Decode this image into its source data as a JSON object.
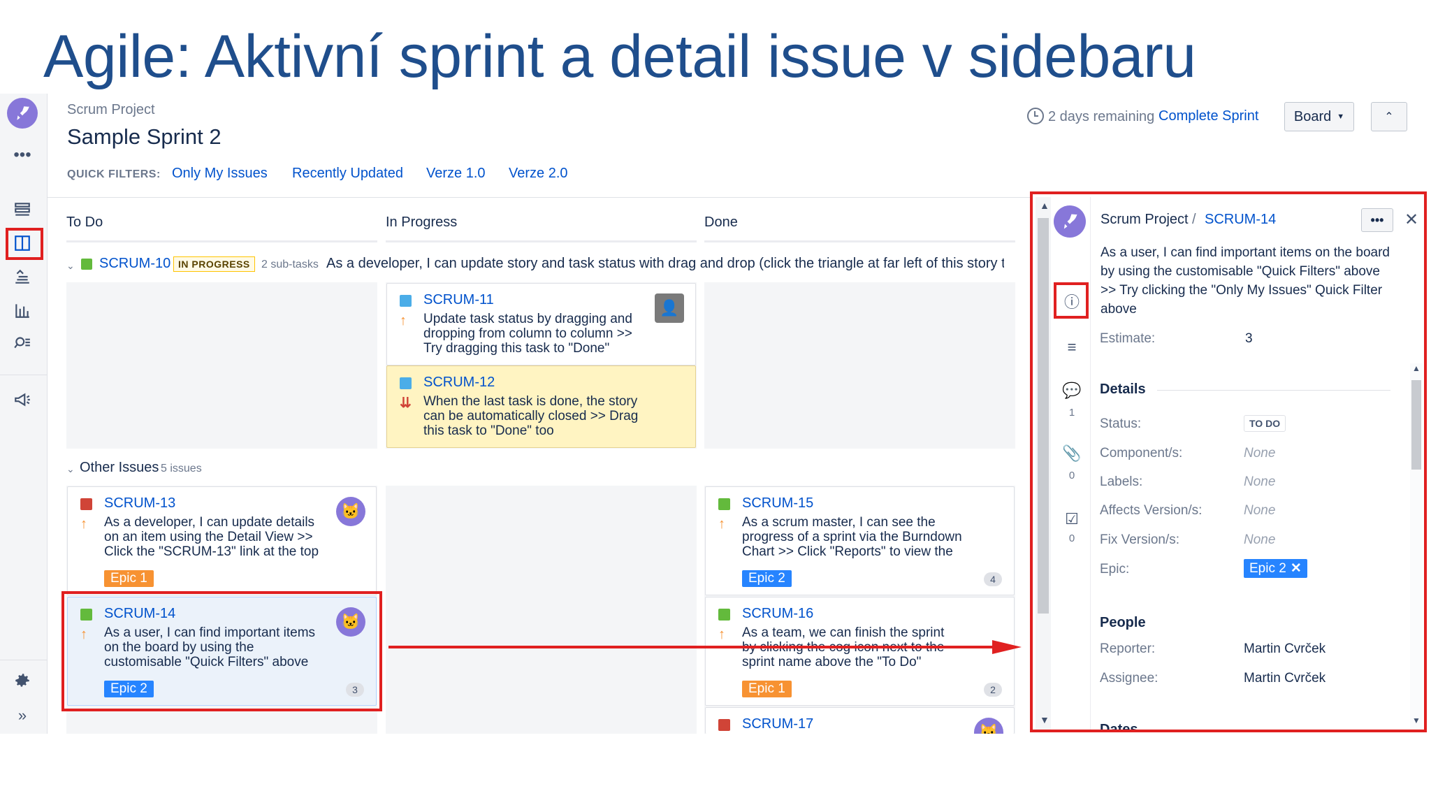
{
  "slide_title": "Agile: Aktivní sprint a detail issue v sidebaru",
  "header": {
    "project": "Scrum Project",
    "sprint": "Sample Sprint 2",
    "remaining": "2 days remaining",
    "complete_sprint": "Complete Sprint",
    "board_button": "Board",
    "collapse_icon": "double-chevron-up-icon"
  },
  "quick_filters": {
    "label": "QUICK FILTERS:",
    "items": [
      "Only My Issues",
      "Recently Updated",
      "Verze 1.0",
      "Verze 2.0"
    ]
  },
  "columns": [
    "To Do",
    "In Progress",
    "Done"
  ],
  "swimlane1": {
    "key": "SCRUM-10",
    "badge": "IN PROGRESS",
    "subtasks": "2 sub-tasks",
    "summary": "As a developer, I can update story and task status with drag and drop (click the triangle at far left of this story to"
  },
  "swimlane2": {
    "title": "Other Issues",
    "count": "5 issues"
  },
  "cards": {
    "scrum11": {
      "key": "SCRUM-11",
      "summary": [
        "Update task status by dragging and",
        "dropping from column to column >>",
        "Try dragging this task to \"Done\""
      ]
    },
    "scrum12": {
      "key": "SCRUM-12",
      "summary": [
        "When the last task is done, the story",
        "can be automatically closed >> Drag",
        "this task to \"Done\" too"
      ]
    },
    "scrum13": {
      "key": "SCRUM-13",
      "summary": [
        "As a developer, I can update details",
        "on an item using the Detail View >>",
        "Click the \"SCRUM-13\" link at the top"
      ],
      "epic": "Epic 1"
    },
    "scrum14": {
      "key": "SCRUM-14",
      "summary": [
        "As a user, I can find important items",
        "on the board by using the",
        "customisable \"Quick Filters\" above"
      ],
      "epic": "Epic 2",
      "estimate": "3"
    },
    "scrum15": {
      "key": "SCRUM-15",
      "summary": [
        "As a scrum master, I can see the",
        "progress of a sprint via the Burndown",
        "Chart >> Click \"Reports\" to view the"
      ],
      "epic": "Epic 2",
      "estimate": "4"
    },
    "scrum16": {
      "key": "SCRUM-16",
      "summary": [
        "As a team, we can finish the sprint",
        "by clicking the cog icon next to the",
        "sprint name above the \"To Do\""
      ],
      "epic": "Epic 1",
      "estimate": "2"
    },
    "scrum17": {
      "key": "SCRUM-17"
    }
  },
  "detail": {
    "project": "Scrum Project",
    "separator": "/",
    "key": "SCRUM-14",
    "summary": [
      "As a user, I can find important items on the board",
      "by using the customisable \"Quick Filters\" above",
      ">> Try clicking the \"Only My Issues\" Quick Filter",
      "above"
    ],
    "estimate_label": "Estimate:",
    "estimate_value": "3",
    "details_heading": "Details",
    "status_label": "Status:",
    "status_value": "TO DO",
    "components_label": "Component/s:",
    "components_value": "None",
    "labels_label": "Labels:",
    "labels_value": "None",
    "affects_label": "Affects Version/s:",
    "affects_value": "None",
    "fix_label": "Fix Version/s:",
    "fix_value": "None",
    "epic_label": "Epic:",
    "epic_value": "Epic 2",
    "people_heading": "People",
    "reporter_label": "Reporter:",
    "reporter_value": "Martin Cvrček",
    "assignee_label": "Assignee:",
    "assignee_value": "Martin Cvrček",
    "dates_heading": "Dates",
    "comments_count": "1",
    "attachments_count": "0",
    "subtasks_count": "0"
  },
  "colors": {
    "link": "#0052cc",
    "highlight": "#e02020",
    "epic_orange": "#f79232",
    "epic_blue": "#2684ff",
    "title": "#1f4e8c"
  }
}
